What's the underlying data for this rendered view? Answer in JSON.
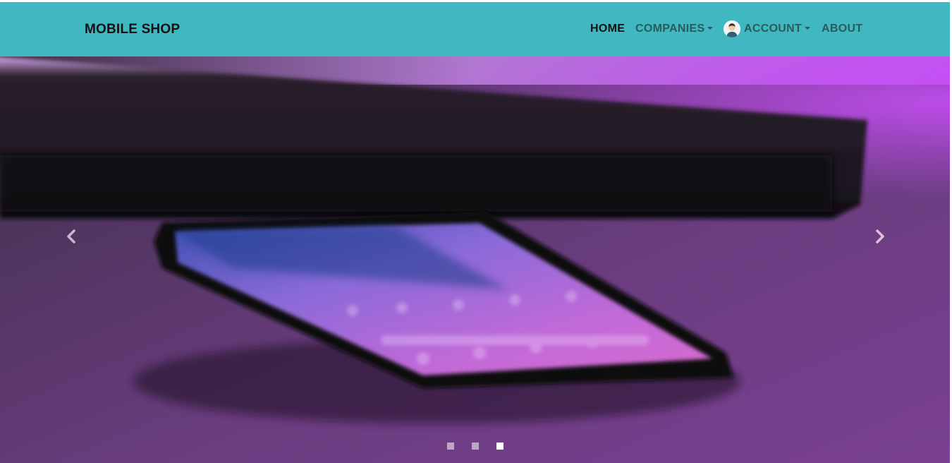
{
  "navbar": {
    "brand": "MOBILE SHOP",
    "background": "#3fb8c1",
    "items": [
      {
        "label": "HOME",
        "active": true
      },
      {
        "label": "COMPANIES",
        "dropdown": true
      },
      {
        "label": "ACCOUNT",
        "dropdown": true,
        "icon": "user-avatar-icon"
      },
      {
        "label": "ABOUT"
      }
    ]
  },
  "carousel": {
    "prev_icon": "chevron-left-icon",
    "next_icon": "chevron-right-icon",
    "slide_count": 3,
    "active_slide": 3,
    "image_subject": "smartphone-on-table-purple-light"
  }
}
